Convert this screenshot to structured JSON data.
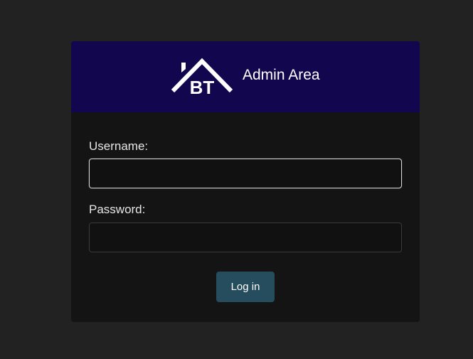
{
  "header": {
    "title": "Admin Area",
    "logo_text": "BT",
    "background_color": "#12074f"
  },
  "form": {
    "username_label": "Username:",
    "username_value": "",
    "password_label": "Password:",
    "password_value": "",
    "submit_label": "Log in",
    "submit_color": "#254d5e"
  }
}
